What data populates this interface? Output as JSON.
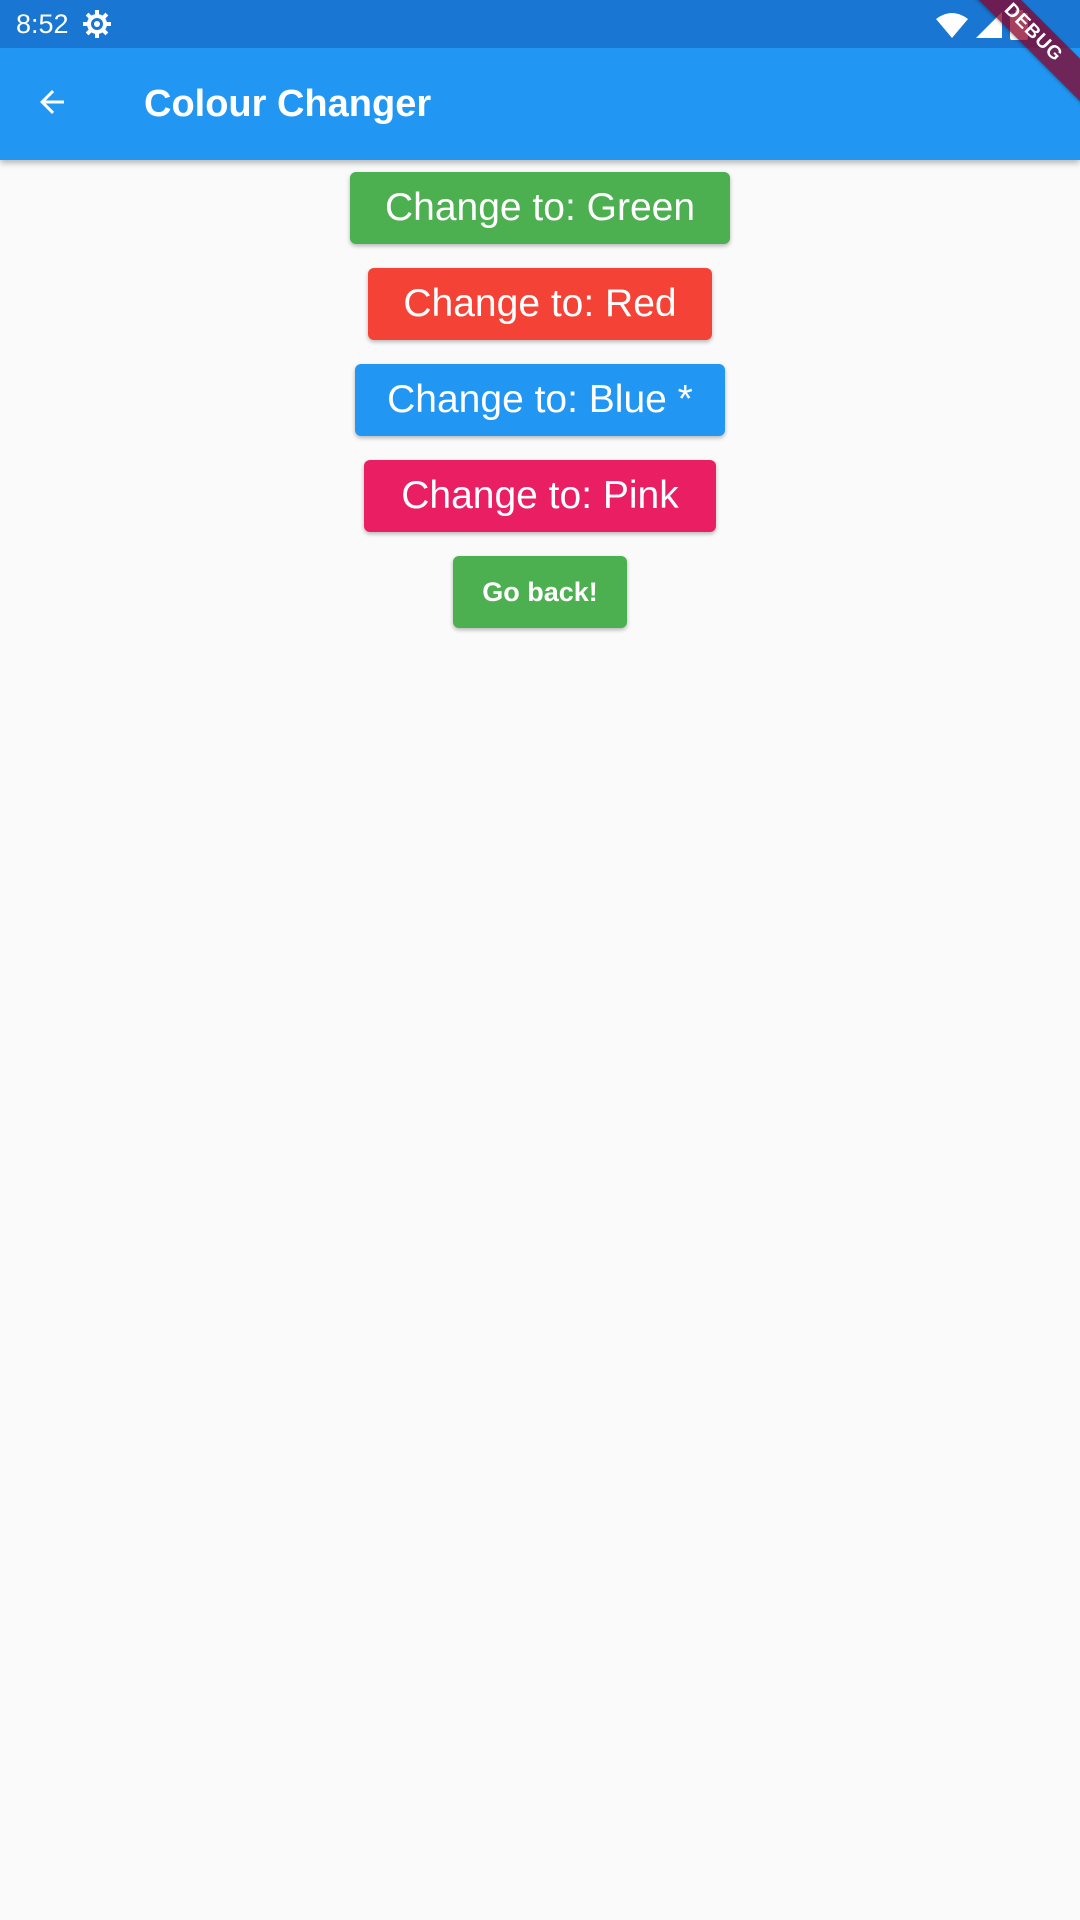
{
  "status_bar": {
    "time": "8:52",
    "icons": [
      "settings-gear-icon",
      "wifi-icon",
      "cellular-signal-icon",
      "battery-icon"
    ]
  },
  "app_bar": {
    "title": "Colour Changer",
    "back_icon": "arrow-back-icon"
  },
  "debug_banner": {
    "label": "DEBUG"
  },
  "buttons": {
    "green": {
      "label": "Change to: Green",
      "color": "#4caf50"
    },
    "red": {
      "label": "Change to: Red",
      "color": "#f44336"
    },
    "blue": {
      "label": "Change to: Blue *",
      "color": "#2196f3"
    },
    "pink": {
      "label": "Change to: Pink",
      "color": "#e91e63"
    },
    "go_back": {
      "label": "Go back!",
      "color": "#4caf50"
    }
  },
  "colors": {
    "status_bar": "#1976d2",
    "app_bar": "#2196f3",
    "background": "#fafafa"
  }
}
